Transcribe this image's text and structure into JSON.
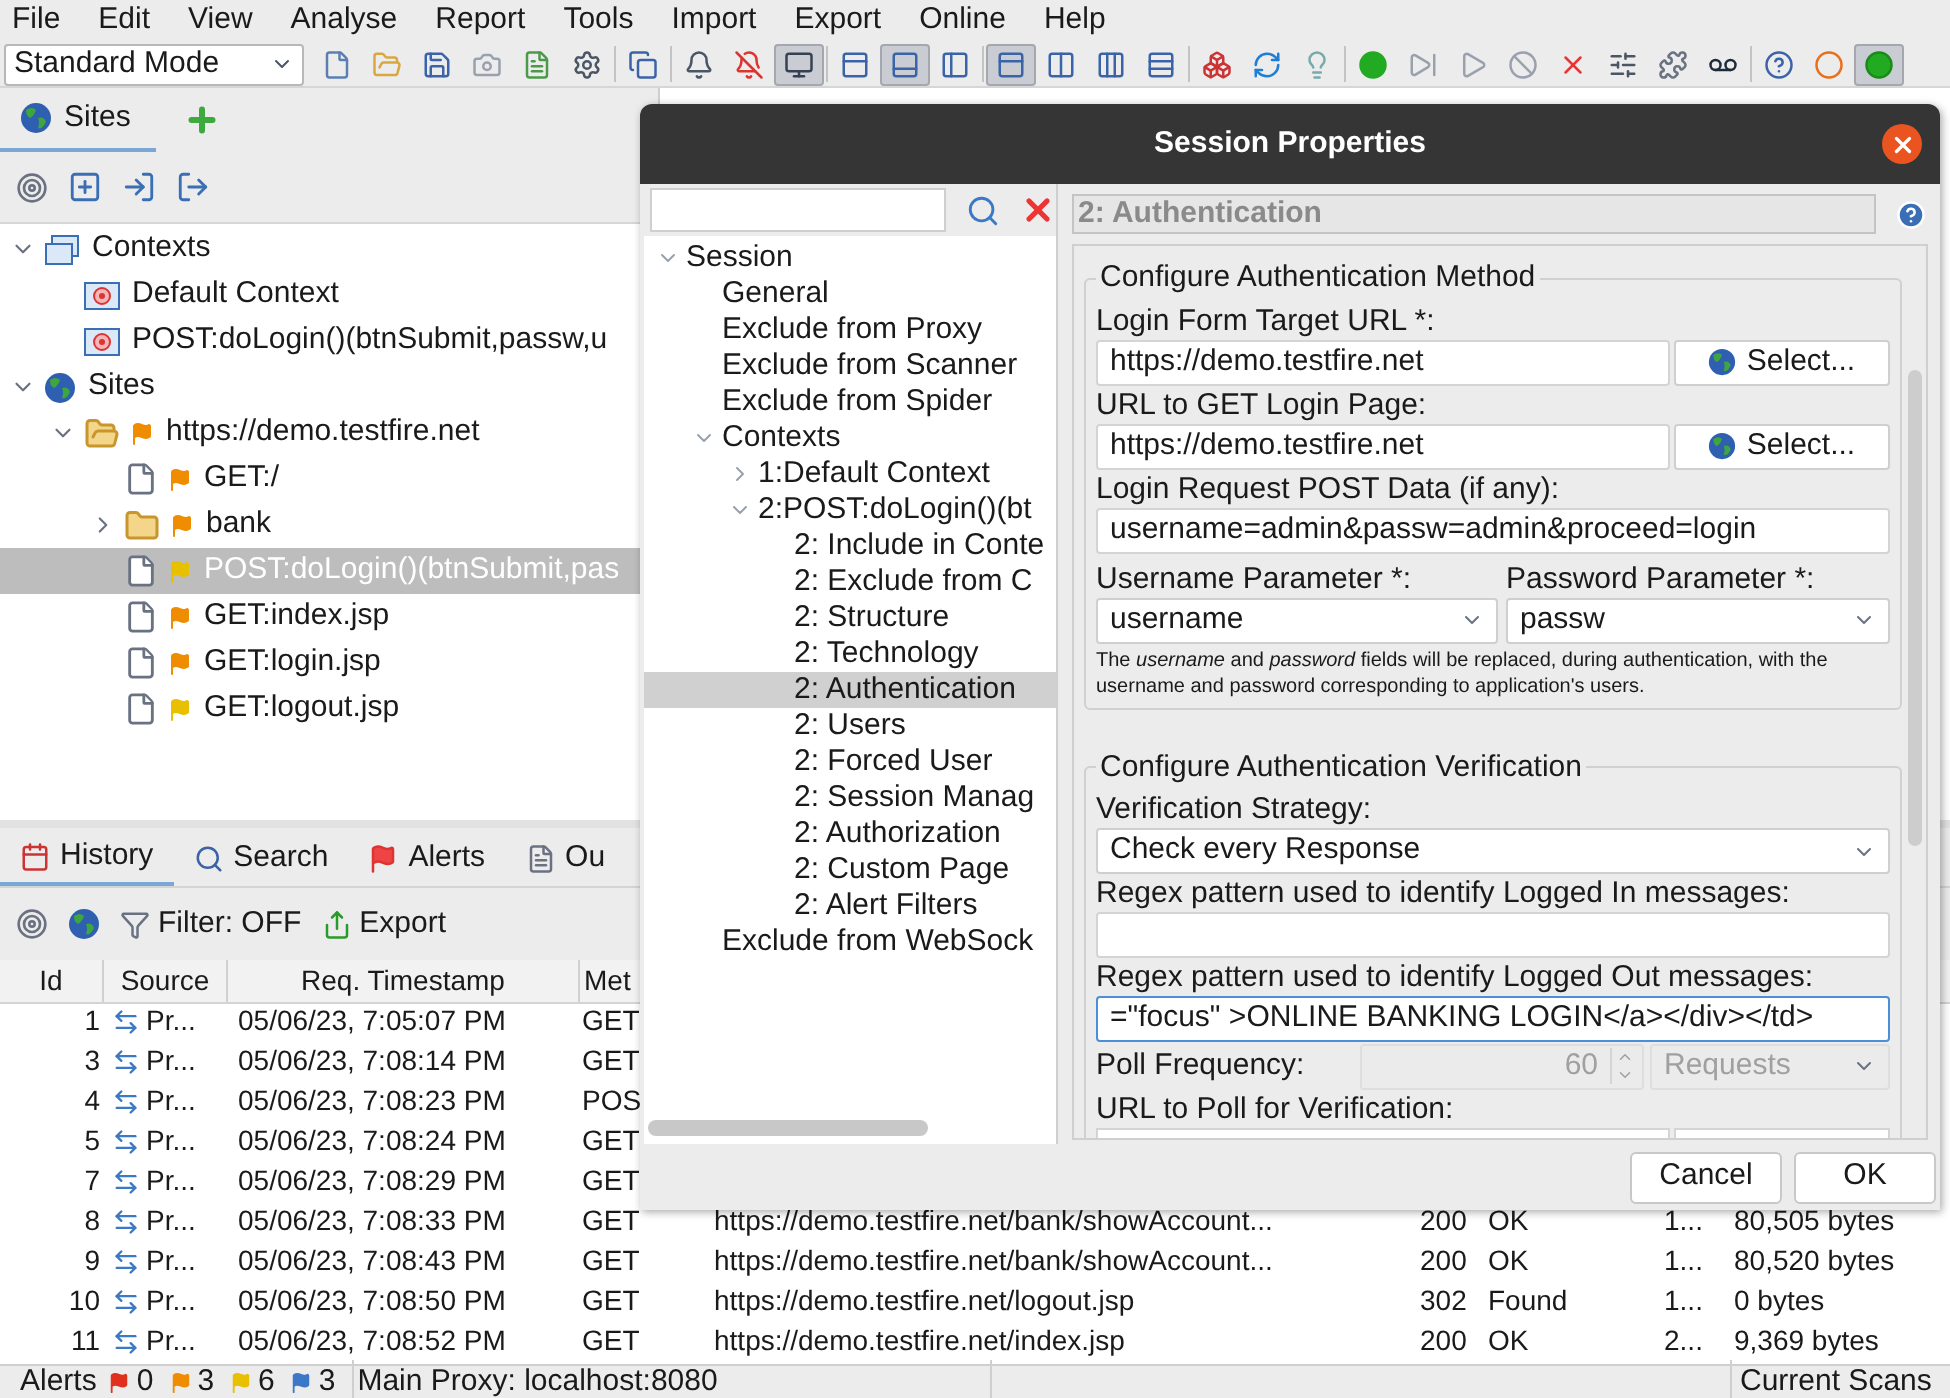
{
  "menu": [
    "File",
    "Edit",
    "View",
    "Analyse",
    "Report",
    "Tools",
    "Import",
    "Export",
    "Online",
    "Help"
  ],
  "toolbar": {
    "mode": "Standard Mode",
    "buttons": [
      {
        "pressed": false
      },
      {
        "pressed": false
      },
      {
        "pressed": false
      },
      {
        "pressed": false
      },
      {
        "pressed": false
      },
      {
        "pressed": false
      },
      {
        "pressed": false
      },
      {
        "pressed": false
      },
      {
        "pressed": false
      },
      {
        "pressed": true
      },
      {
        "pressed": false
      },
      {
        "pressed": true
      },
      {
        "pressed": false
      },
      {
        "pressed": true
      },
      {
        "pressed": false
      },
      {
        "pressed": false
      },
      {
        "pressed": false
      },
      {
        "pressed": false
      },
      {
        "pressed": false
      },
      {
        "pressed": false
      },
      {
        "pressed": false
      },
      {
        "pressed": false
      },
      {
        "pressed": false
      },
      {
        "pressed": false
      },
      {
        "pressed": false
      },
      {
        "pressed": false
      },
      {
        "pressed": false
      },
      {
        "pressed": false
      },
      {
        "pressed": false
      },
      {
        "pressed": false
      },
      {
        "pressed": true
      }
    ]
  },
  "sites_panel": {
    "tab": "Sites",
    "tree": [
      {
        "label": "Contexts",
        "kind": "contexts",
        "expanded": true,
        "selected": false,
        "children": [
          {
            "label": "Default Context",
            "kind": "context",
            "selected": false
          },
          {
            "label": "POST:doLogin()(btnSubmit,passw,u",
            "kind": "context",
            "selected": false
          }
        ]
      },
      {
        "label": "Sites",
        "kind": "sites",
        "expanded": true,
        "selected": false,
        "children": [
          {
            "label": "https://demo.testfire.net",
            "kind": "site",
            "color": "#f08c00",
            "expanded": true,
            "selected": false,
            "children": [
              {
                "label": "GET:/",
                "kind": "page",
                "color": "#f08c00",
                "selected": false
              },
              {
                "label": "bank",
                "kind": "folder",
                "color": "#f08c00",
                "expanded": false,
                "selected": false
              },
              {
                "label": "POST:doLogin()(btnSubmit,pas",
                "kind": "page",
                "color": "#e8c000",
                "selected": true
              },
              {
                "label": "GET:index.jsp",
                "kind": "page",
                "color": "#f08c00",
                "selected": false
              },
              {
                "label": "GET:login.jsp",
                "kind": "page",
                "color": "#f08c00",
                "selected": false
              },
              {
                "label": "GET:logout.jsp",
                "kind": "page",
                "color": "#e8c000",
                "selected": false
              }
            ]
          }
        ]
      }
    ]
  },
  "bottom_panel": {
    "tabs": [
      {
        "label": "History",
        "selected": true
      },
      {
        "label": "Search",
        "selected": false
      },
      {
        "label": "Alerts",
        "selected": false
      },
      {
        "label": "Ou",
        "selected": false
      }
    ],
    "filter": "Filter: OFF",
    "export": "Export",
    "table": {
      "columns": [
        "Id",
        "Source",
        "Req. Timestamp",
        "Met"
      ],
      "rows": [
        {
          "id": "1",
          "source": "Pr...",
          "timestamp": "05/06/23, 7:05:07 PM",
          "method": "GET"
        },
        {
          "id": "3",
          "source": "Pr...",
          "timestamp": "05/06/23, 7:08:14 PM",
          "method": "GET"
        },
        {
          "id": "4",
          "source": "Pr...",
          "timestamp": "05/06/23, 7:08:23 PM",
          "method": "POS"
        },
        {
          "id": "5",
          "source": "Pr...",
          "timestamp": "05/06/23, 7:08:24 PM",
          "method": "GET"
        },
        {
          "id": "7",
          "source": "Pr...",
          "timestamp": "05/06/23, 7:08:29 PM",
          "method": "GET"
        },
        {
          "id": "8",
          "source": "Pr...",
          "timestamp": "05/06/23, 7:08:33 PM",
          "method": "GET",
          "url": "https://demo.testfire.net/bank/showAccount...",
          "code": "200",
          "reason": "OK",
          "rtt": "1...",
          "size": "80,505 bytes"
        },
        {
          "id": "9",
          "source": "Pr...",
          "timestamp": "05/06/23, 7:08:43 PM",
          "method": "GET",
          "url": "https://demo.testfire.net/bank/showAccount...",
          "code": "200",
          "reason": "OK",
          "rtt": "1...",
          "size": "80,520 bytes"
        },
        {
          "id": "10",
          "source": "Pr...",
          "timestamp": "05/06/23, 7:08:50 PM",
          "method": "GET",
          "url": "https://demo.testfire.net/logout.jsp",
          "code": "302",
          "reason": "Found",
          "rtt": "1...",
          "size": "0 bytes"
        },
        {
          "id": "11",
          "source": "Pr...",
          "timestamp": "05/06/23, 7:08:52 PM",
          "method": "GET",
          "url": "https://demo.testfire.net/index.jsp",
          "code": "200",
          "reason": "OK",
          "rtt": "2...",
          "size": "9,369 bytes"
        }
      ]
    }
  },
  "dialog": {
    "title": "Session Properties",
    "tree": [
      {
        "label": "Session",
        "expanded": true,
        "selected": false,
        "children": [
          {
            "label": "General",
            "selected": false
          },
          {
            "label": "Exclude from Proxy",
            "selected": false
          },
          {
            "label": "Exclude from Scanner",
            "selected": false
          },
          {
            "label": "Exclude from Spider",
            "selected": false
          },
          {
            "label": "Contexts",
            "expanded": true,
            "selected": false,
            "children": [
              {
                "label": "1:Default Context",
                "expanded": false,
                "selected": false
              },
              {
                "label": "2:POST:doLogin()(bt",
                "expanded": true,
                "selected": false,
                "children": [
                  {
                    "label": "2: Include in Conte",
                    "selected": false
                  },
                  {
                    "label": "2: Exclude from C",
                    "selected": false
                  },
                  {
                    "label": "2: Structure",
                    "selected": false
                  },
                  {
                    "label": "2: Technology",
                    "selected": false
                  },
                  {
                    "label": "2: Authentication",
                    "selected": true
                  },
                  {
                    "label": "2: Users",
                    "selected": false
                  },
                  {
                    "label": "2: Forced User",
                    "selected": false
                  },
                  {
                    "label": "2: Session Manag",
                    "selected": false
                  },
                  {
                    "label": "2: Authorization",
                    "selected": false
                  },
                  {
                    "label": "2: Custom Page",
                    "selected": false
                  },
                  {
                    "label": "2: Alert Filters",
                    "selected": false
                  }
                ]
              }
            ]
          },
          {
            "label": "Exclude from WebSock",
            "selected": false
          }
        ]
      }
    ],
    "page_title": "2: Authentication",
    "auth_method": {
      "legend": "Configure Authentication Method",
      "target_url_label": "Login Form Target URL *:",
      "target_url": "https://demo.testfire.net",
      "target_url_button": "Select...",
      "login_page_label": "URL to GET Login Page:",
      "login_page_url": "https://demo.testfire.net",
      "login_page_button": "Select...",
      "post_data_label": "Login Request POST Data (if any):",
      "post_data": "username=admin&passw=admin&proceed=login",
      "username_param_label": "Username Parameter *:",
      "username_param": "username",
      "password_param_label": "Password Parameter *:",
      "password_param": "passw",
      "note": "The *username* and *password* fields will be replaced, during authentication, with the username and password corresponding to application's users."
    },
    "verification": {
      "legend": "Configure Authentication Verification",
      "strategy_label": "Verification Strategy:",
      "strategy": "Check every Response",
      "logged_in_label": "Regex pattern used to identify Logged In messages:",
      "logged_out_label": "Regex pattern used to identify Logged Out messages:",
      "logged_out": "=\"focus\" >ONLINE BANKING LOGIN</a></div></td>",
      "poll_label": "Poll Frequency:",
      "poll_value": "60",
      "poll_unit": "Requests",
      "poll_disabled": true,
      "poll_url_label": "URL to Poll for Verification:"
    },
    "buttons": [
      "Cancel",
      "OK"
    ]
  },
  "status_bar": {
    "alerts_label": "Alerts",
    "alert_counts": [
      {
        "count": "0",
        "color": "#e0301e"
      },
      {
        "count": "3",
        "color": "#f08c00"
      },
      {
        "count": "6",
        "color": "#e8c000"
      },
      {
        "count": "3",
        "color": "#3c78c8"
      }
    ],
    "proxy": "Main Proxy: localhost:8080",
    "scans": "Current Scans"
  }
}
